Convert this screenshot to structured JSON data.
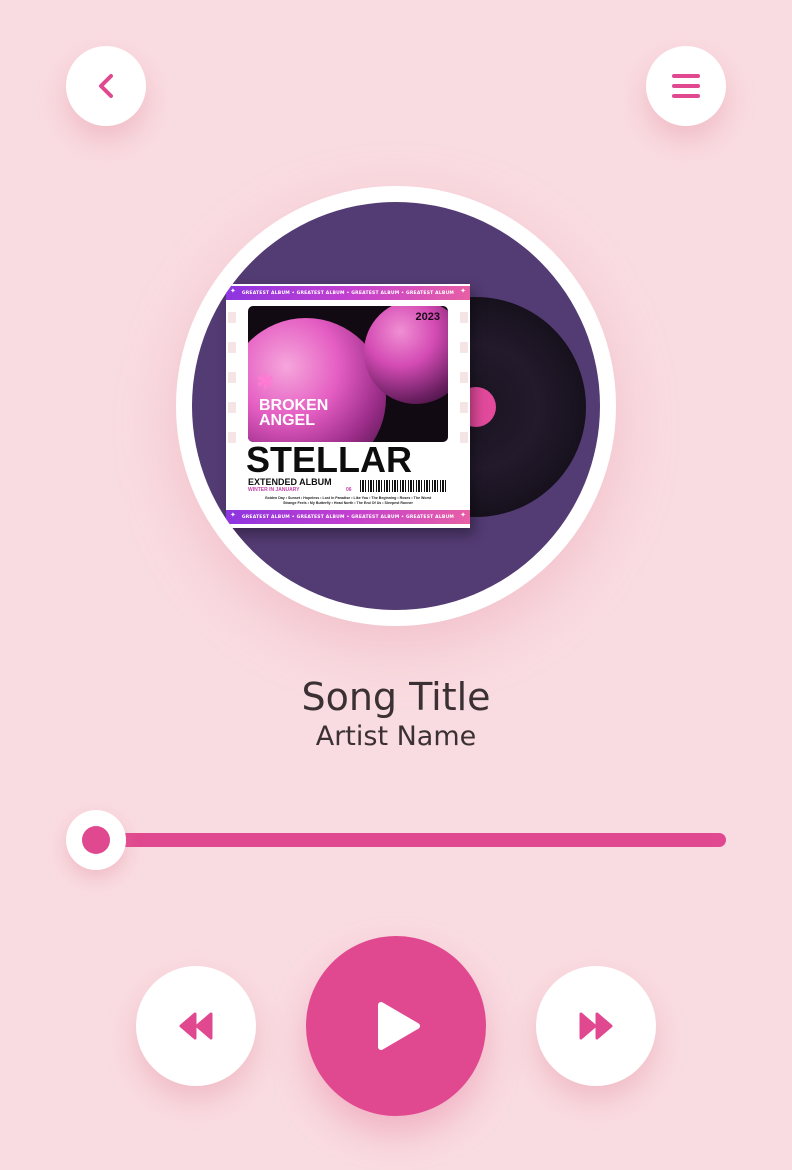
{
  "header": {
    "back_icon": "chevron-left-icon",
    "menu_icon": "hamburger-menu-icon"
  },
  "album_art": {
    "band_text": "GREATEST ALBUM • GREATEST ALBUM • GREATEST ALBUM • GREATEST ALBUM",
    "year": "2023",
    "cover_title_line1": "BROKEN",
    "cover_title_line2": "ANGEL",
    "album_name": "STELLAR",
    "album_subtitle": "EXTENDED ALBUM",
    "release_note": "WINTER IN JANUARY",
    "badge": "06",
    "tracklist_line1": "Golden Day • Sunset • Hopeless • Lost In Paradise • Like You • The Beginning • Roses • The Worst",
    "tracklist_line2": "Strange Feels • My Butterfly • Head North • The End Of Us • Sleepest Runner"
  },
  "track": {
    "title": "Song Title",
    "artist": "Artist Name",
    "progress": 0.0
  },
  "controls": {
    "prev_icon": "rewind-icon",
    "play_icon": "play-icon",
    "next_icon": "fast-forward-icon"
  },
  "colors": {
    "background": "#f9dce1",
    "accent": "#e0488f",
    "cover_circle": "#533b73",
    "text": "#3b3134"
  }
}
